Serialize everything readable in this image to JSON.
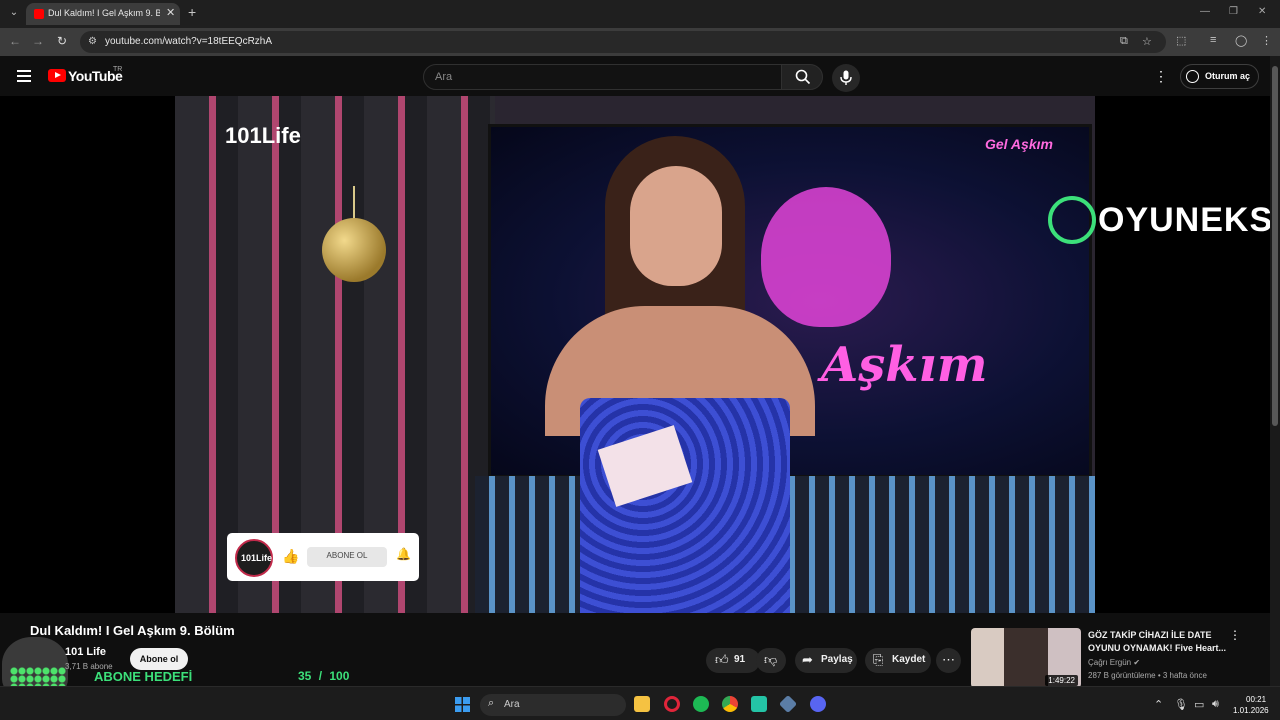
{
  "browser": {
    "tab_title": "Dul Kaldım! I Gel Aşkım 9. Bölüm",
    "url": "youtube.com/watch?v=18tEEQcRzhA"
  },
  "youtube": {
    "logo_text": "YouTube",
    "region": "TR",
    "search_placeholder": "Ara",
    "signin_label": "Oturum aç"
  },
  "video": {
    "title": "Dul Kaldım! I Gel Aşkım 9. Bölüm",
    "channel_logo": "101Life",
    "show_logo": "Gel Aşkım",
    "screen_text": "Aşkım",
    "overlay_brand": "OYUNEKS",
    "widget_avatar_label": "101Life",
    "widget_button_label": "ABONE OL"
  },
  "meta": {
    "channel": "101 Life",
    "subscribers": "3,71 B abone",
    "subscribe_label": "Abone ol",
    "likes": "91",
    "share_label": "Paylaş",
    "save_label": "Kaydet"
  },
  "goal": {
    "label": "ABONE HEDEFİ",
    "current": "35",
    "target": "/ 100",
    "progress": 0.35
  },
  "recommendation": {
    "title": "GÖZ TAKİP CİHAZI İLE DATE OYUNU OYNAMAK! Five Heart...",
    "channel": "Çağrı Ergün",
    "views": "287 B görüntüleme",
    "age": "3 hafta önce",
    "duration": "1:49:22"
  },
  "taskbar": {
    "search_label": "Ara",
    "time": "00:21",
    "date": "1.01.2026"
  },
  "colors": {
    "goal_green": "#3ce07a",
    "yt_red": "#ff0000",
    "background": "#0f0f0f"
  }
}
